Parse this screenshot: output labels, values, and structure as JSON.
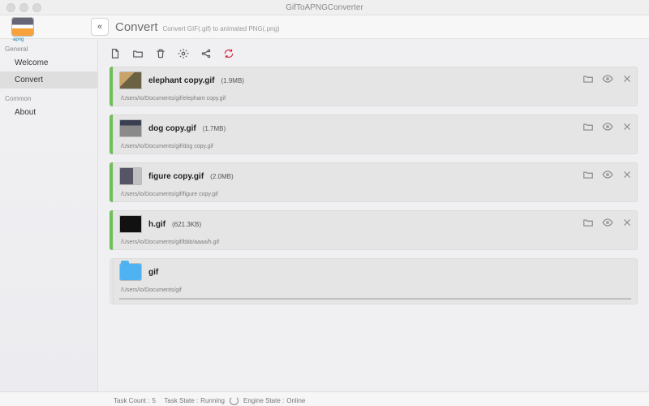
{
  "window": {
    "title": "GifToAPNGConverter"
  },
  "header": {
    "logo_sub": "·apng",
    "back_glyph": "«",
    "title": "Convert",
    "subtitle": "Convert GIF(.gif) to animated PNG(.png)"
  },
  "sidebar": {
    "sections": [
      {
        "label": "General",
        "items": [
          {
            "label": "Welcome",
            "active": false
          },
          {
            "label": "Convert",
            "active": true
          }
        ]
      },
      {
        "label": "Common",
        "items": [
          {
            "label": "About",
            "active": false
          }
        ]
      }
    ]
  },
  "toolbar": {
    "icons": [
      "new-file-icon",
      "open-folder-icon",
      "trash-icon",
      "gear-icon",
      "share-icon",
      "refresh-icon"
    ]
  },
  "files": [
    {
      "thumb_class": "t1",
      "name": "elephant copy.gif",
      "size": "(1.9MB)",
      "path": "/Users/Io/Documents/gif/elephant copy.gif",
      "kind": "file"
    },
    {
      "thumb_class": "t2",
      "name": "dog copy.gif",
      "size": "(1.7MB)",
      "path": "/Users/Io/Documents/gif/dog copy.gif",
      "kind": "file"
    },
    {
      "thumb_class": "t3",
      "name": "figure copy.gif",
      "size": "(2.0MB)",
      "path": "/Users/Io/Documents/gif/figure copy.gif",
      "kind": "file"
    },
    {
      "thumb_class": "t4",
      "name": "h.gif",
      "size": "(621.3KB)",
      "path": "/Users/Io/Documents/gif/bbb/aaaa/h.gif",
      "kind": "file"
    },
    {
      "thumb_class": "fold",
      "name": "gif",
      "size": "",
      "path": "/Users/Io/Documents/gif",
      "kind": "folder"
    }
  ],
  "status": {
    "task_count_label": "Task Count :",
    "task_count": "5",
    "task_state_label": "Task State :",
    "task_state": "Running",
    "engine_label": "Engine State :",
    "engine_state": "Online"
  }
}
